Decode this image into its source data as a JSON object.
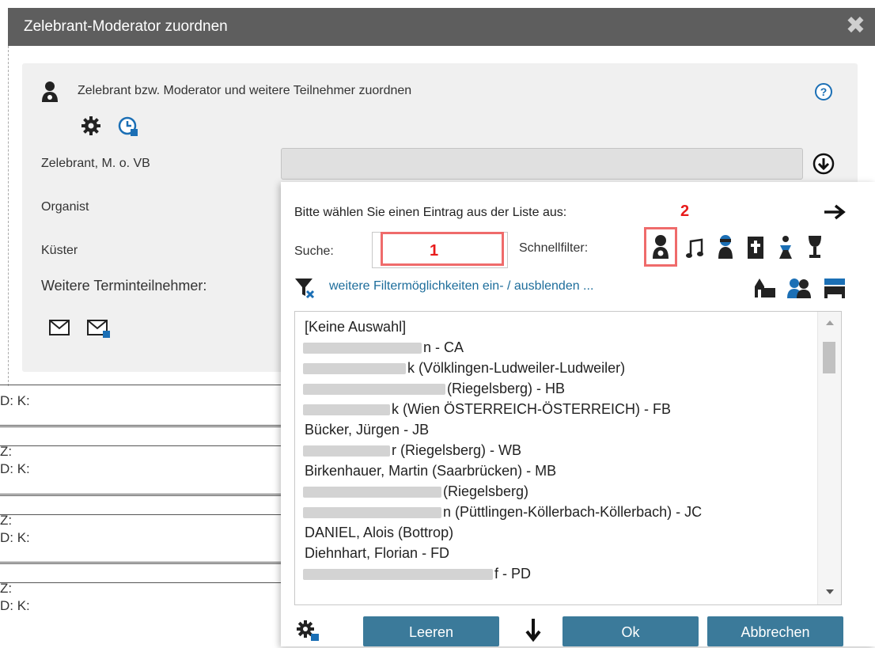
{
  "dialog": {
    "title": "Zelebrant-Moderator zuordnen",
    "close": "✖",
    "header_text": "Zelebrant bzw. Moderator und weitere Teilnehmer zuordnen",
    "help": "?"
  },
  "fields": {
    "zelebrant": "Zelebrant, M. o. VB",
    "organist": "Organist",
    "kuester": "Küster",
    "weitere": "Weitere Terminteilnehmer:"
  },
  "background_rows": [
    "D: K:",
    "Z:",
    "D: K:",
    "Z:",
    "D: K:",
    "Z:",
    "D: K:"
  ],
  "popup": {
    "prompt": "Bitte wählen Sie einen Eintrag aus der Liste aus:",
    "marker_2": "2",
    "search_label": "Suche:",
    "search_value": "",
    "marker_1": "1",
    "quickfilter_label": "Schnellfilter:",
    "filter_link": "weitere Filtermöglichkeiten ein- / ausblenden ...",
    "list_items": [
      {
        "visible": "[Keine Auswahl]",
        "blur": 0
      },
      {
        "visible": "n - CA",
        "blur": 150
      },
      {
        "visible": "k (Völklingen-Ludweiler-Ludweiler)",
        "blur": 130
      },
      {
        "visible": "(Riegelsberg) - HB",
        "blur": 180
      },
      {
        "visible": "k (Wien ÖSTERREICH-ÖSTERREICH) - FB",
        "blur": 110
      },
      {
        "visible": "Bücker, Jürgen - JB",
        "blur": 0
      },
      {
        "visible": "r (Riegelsberg) - WB",
        "blur": 110
      },
      {
        "visible": "Birkenhauer, Martin (Saarbrücken) - MB",
        "blur": 0
      },
      {
        "visible": "(Riegelsberg)",
        "blur": 175
      },
      {
        "visible": "n (Püttlingen-Köllerbach-Köllerbach) - JC",
        "blur": 175
      },
      {
        "visible": "DANIEL, Alois (Bottrop)",
        "blur": 0
      },
      {
        "visible": "Diehnhart, Florian - FD",
        "blur": 0
      },
      {
        "visible": "f - PD",
        "blur": 240
      }
    ],
    "buttons": {
      "leeren": "Leeren",
      "ok": "Ok",
      "abbrechen": "Abbrechen"
    }
  },
  "colors": {
    "titlebar": "#5e5e5e",
    "button": "#3b7a9a",
    "highlight": "#ef6b6b",
    "link": "#1d6d9b"
  }
}
